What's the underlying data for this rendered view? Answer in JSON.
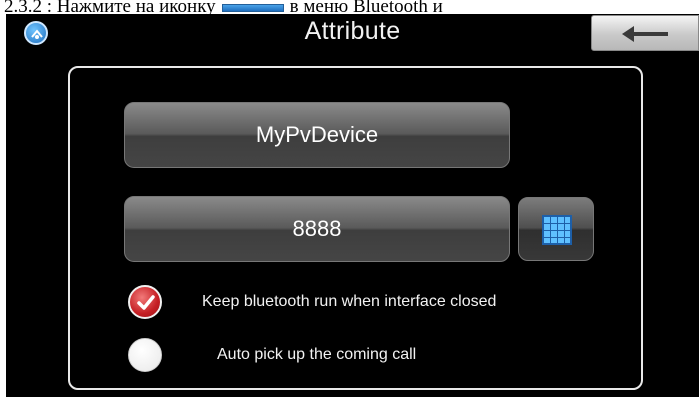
{
  "doc": {
    "prefix_text": "2.3.2 : Нажмите на иконку",
    "suffix_text": "в меню Bluetooth и"
  },
  "header": {
    "title": "Attribute",
    "back_icon": "back-arrow-icon",
    "app_icon": "bluetooth-app-icon"
  },
  "device": {
    "name": "MyPvDevice",
    "pin": "8888",
    "keypad_icon": "keypad-icon"
  },
  "options": [
    {
      "label": "Keep bluetooth run when interface closed",
      "checked": true
    },
    {
      "label": "Auto pick up the coming call",
      "checked": false
    }
  ],
  "colors": {
    "background": "#000000",
    "checked": "#c51f24",
    "keypad_accent": "#3aa0f0"
  }
}
